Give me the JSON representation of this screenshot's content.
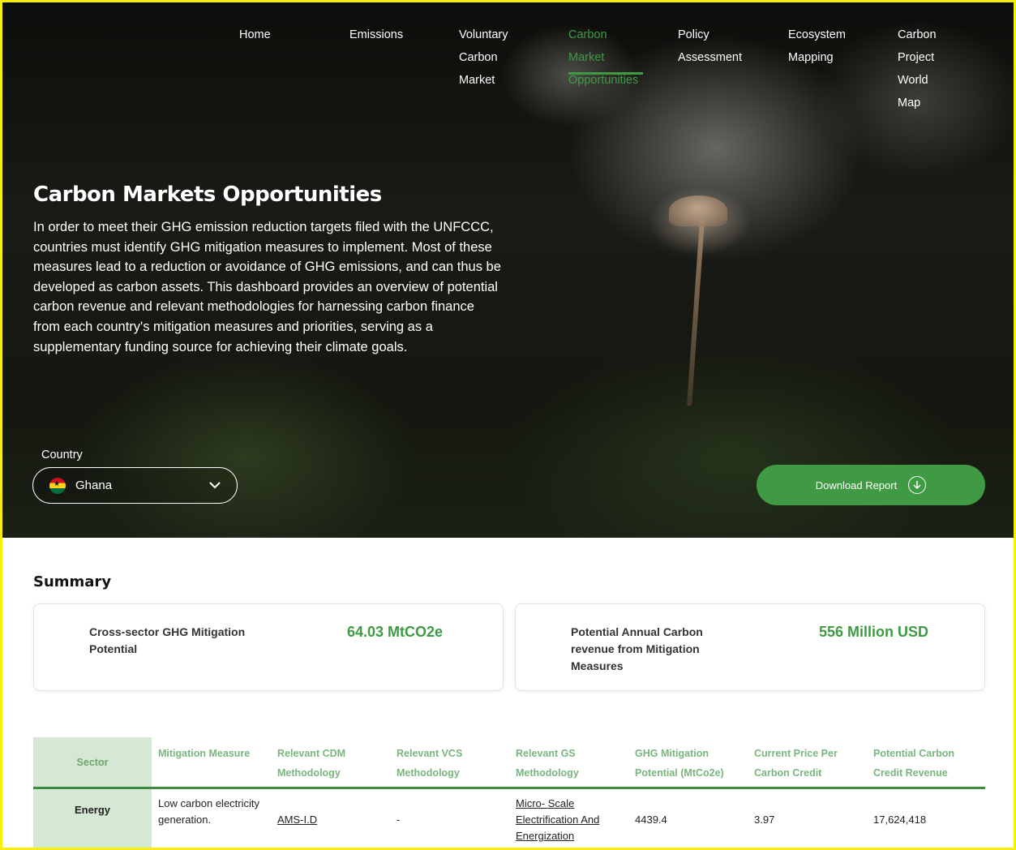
{
  "nav": {
    "items": [
      {
        "line1": "Home",
        "line2": ""
      },
      {
        "line1": "Emissions",
        "line2": ""
      },
      {
        "line1": "Voluntary",
        "line2": "Carbon Market"
      },
      {
        "line1": "Carbon Market",
        "line2": "Opportunities"
      },
      {
        "line1": "Policy",
        "line2": "Assessment"
      },
      {
        "line1": "Ecosystem",
        "line2": "Mapping"
      },
      {
        "line1": "Carbon Project",
        "line2": "World Map"
      }
    ],
    "active_color": "#3e9a43"
  },
  "hero": {
    "title": "Carbon Markets Opportunities",
    "description": "In order to meet their GHG emission reduction targets filed with the UNFCCC, countries must identify GHG mitigation measures to implement. Most of these measures lead to a reduction or avoidance of GHG emissions, and can thus be developed as carbon assets. This dashboard provides an overview of potential carbon revenue and relevant methodologies for harnessing carbon finance from each country's mitigation measures and priorities, serving as a supplementary funding source for achieving their climate goals."
  },
  "country": {
    "label": "Country",
    "value": "Ghana",
    "flag_icon": "ghana-flag-icon"
  },
  "download": {
    "label": "Download Report",
    "icon": "download-icon"
  },
  "summary": {
    "title": "Summary",
    "cards": [
      {
        "label": "Cross-sector GHG Mitigation Potential",
        "value": "64.03 MtCO2e"
      },
      {
        "label": "Potential Annual Carbon revenue from Mitigation Measures",
        "value": "556 Million USD"
      }
    ]
  },
  "table": {
    "headers": {
      "sector": "Sector",
      "measure": "Mitigation Measure",
      "cdm": "Relevant CDM Methodology",
      "vcs": "Relevant VCS Methodology",
      "gs": "Relevant GS Methodology",
      "ghg": "GHG Mitigation Potential (MtCo2e)",
      "price": "Current Price Per Carbon Credit",
      "revenue": "Potential Carbon Credit Revenue"
    },
    "rows": [
      {
        "sector": "Energy",
        "measure": "Low carbon electricity generation.",
        "cdm": "AMS-I.D",
        "vcs": "-",
        "gs": "Micro- Scale Electrification And Energization",
        "ghg": "4439.4",
        "price": "3.97",
        "revenue": "17,624,418"
      }
    ]
  },
  "colors": {
    "accent": "#3e9a43",
    "sector_bg": "#d4e8d3",
    "header_text": "#7ab57e"
  }
}
